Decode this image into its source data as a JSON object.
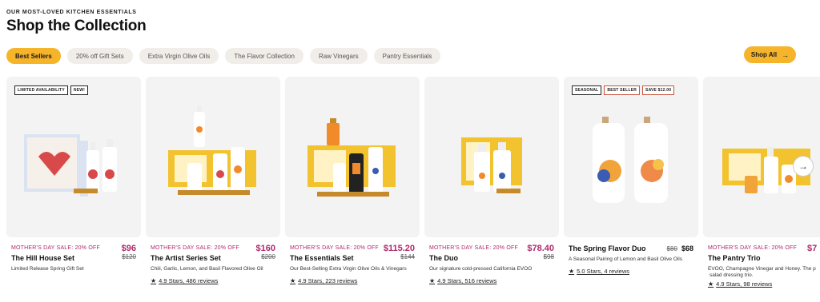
{
  "header": {
    "eyebrow": "OUR MOST-LOVED KITCHEN ESSENTIALS",
    "title": "Shop the Collection"
  },
  "tabs": [
    {
      "label": "Best Sellers",
      "active": true
    },
    {
      "label": "20% off Gift Sets",
      "active": false
    },
    {
      "label": "Extra Virgin Olive Oils",
      "active": false
    },
    {
      "label": "The Flavor Collection",
      "active": false
    },
    {
      "label": "Raw Vinegars",
      "active": false
    },
    {
      "label": "Pantry Essentials",
      "active": false
    }
  ],
  "shop_all": {
    "label": "Shop All",
    "icon": "arrow-right-icon"
  },
  "products": [
    {
      "badges": [
        "LIMITED AVAILABILITY",
        "NEW!"
      ],
      "sale": "MOTHER'S DAY SALE: 20% OFF",
      "price": "$96",
      "old_price": "$120",
      "name": "The Hill House Set",
      "desc": "Limited Release Spring Gift Set",
      "rating": ""
    },
    {
      "badges": [],
      "sale": "MOTHER'S DAY SALE: 20% OFF",
      "price": "$160",
      "old_price": "$200",
      "name": "The Artist Series Set",
      "desc": "Chili, Garlic, Lemon, and Basil Flavored Olive Oil",
      "rating": "4.9 Stars, 486 reviews"
    },
    {
      "badges": [],
      "sale": "MOTHER'S DAY SALE: 20% OFF",
      "price": "$115.20",
      "old_price": "$144",
      "name": "The Essentials Set",
      "desc": "Our Best-Selling Extra Virgin Olive Oils & Vinegars",
      "rating": "4.9 Stars, 223 reviews"
    },
    {
      "badges": [],
      "sale": "MOTHER'S DAY SALE: 20% OFF",
      "price": "$78.40",
      "old_price": "$98",
      "name": "The Duo",
      "desc": "Our signature cold-pressed California EVOO",
      "rating": "4.9 Stars, 516 reviews"
    },
    {
      "badges": [
        "SEASONAL",
        "BEST SELLER",
        "SAVE $12.00"
      ],
      "sale": "",
      "price": "$68",
      "old_price": "$80",
      "name": "The Spring Flavor Duo",
      "desc": "A Seasonal Pairing of Lemon and Basil Olive Oils",
      "rating": "5.0 Stars, 4 reviews"
    },
    {
      "badges": [],
      "sale": "MOTHER'S DAY SALE: 20% OFF",
      "price": "$7",
      "old_price": "",
      "name": "The Pantry Trio",
      "desc": "EVOO, Champagne Vinegar and Honey. The p",
      "desc2": "salad dressing trio.",
      "rating": "4.9 Stars, 98 reviews"
    }
  ],
  "colors": {
    "accent": "#f5b42a",
    "sale": "#b0286a"
  }
}
